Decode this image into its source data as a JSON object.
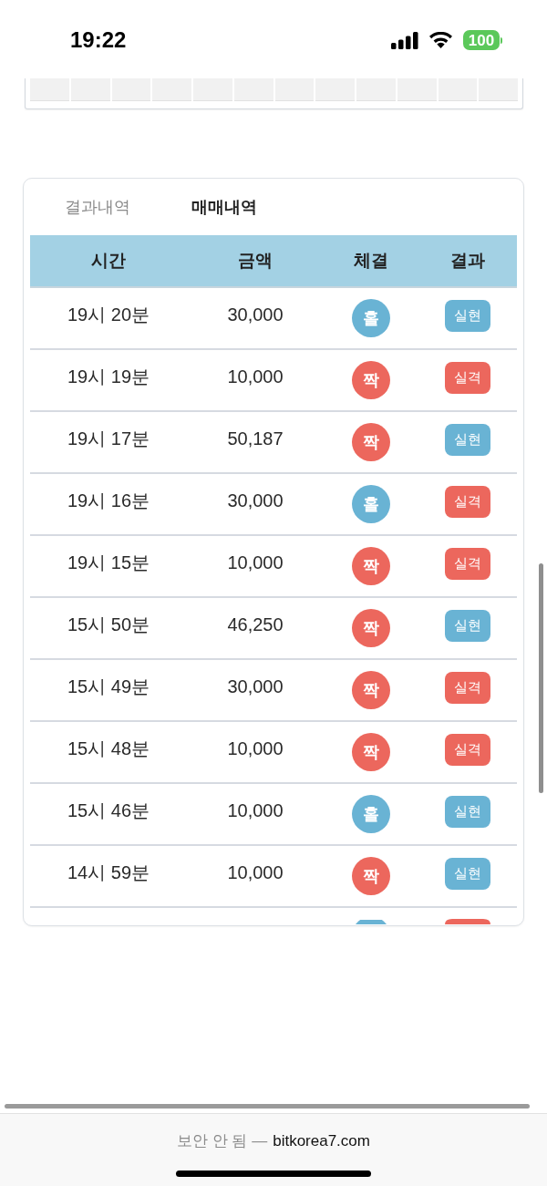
{
  "status_bar": {
    "time": "19:22",
    "battery": "100"
  },
  "tabs": [
    {
      "label": "결과내역",
      "selected": false
    },
    {
      "label": "매매내역",
      "selected": true
    }
  ],
  "table": {
    "columns": [
      "시간",
      "금액",
      "체결",
      "결과"
    ],
    "rows": [
      {
        "time": "19시 20분",
        "amount": "30,000",
        "fill": {
          "label": "홀",
          "kind": "odd"
        },
        "result": {
          "label": "실현",
          "kind": "win"
        }
      },
      {
        "time": "19시 19분",
        "amount": "10,000",
        "fill": {
          "label": "짝",
          "kind": "even"
        },
        "result": {
          "label": "실격",
          "kind": "lose"
        }
      },
      {
        "time": "19시 17분",
        "amount": "50,187",
        "fill": {
          "label": "짝",
          "kind": "even"
        },
        "result": {
          "label": "실현",
          "kind": "win"
        }
      },
      {
        "time": "19시 16분",
        "amount": "30,000",
        "fill": {
          "label": "홀",
          "kind": "odd"
        },
        "result": {
          "label": "실격",
          "kind": "lose"
        }
      },
      {
        "time": "19시 15분",
        "amount": "10,000",
        "fill": {
          "label": "짝",
          "kind": "even"
        },
        "result": {
          "label": "실격",
          "kind": "lose"
        }
      },
      {
        "time": "15시 50분",
        "amount": "46,250",
        "fill": {
          "label": "짝",
          "kind": "even"
        },
        "result": {
          "label": "실현",
          "kind": "win"
        }
      },
      {
        "time": "15시 49분",
        "amount": "30,000",
        "fill": {
          "label": "짝",
          "kind": "even"
        },
        "result": {
          "label": "실격",
          "kind": "lose"
        }
      },
      {
        "time": "15시 48분",
        "amount": "10,000",
        "fill": {
          "label": "짝",
          "kind": "even"
        },
        "result": {
          "label": "실격",
          "kind": "lose"
        }
      },
      {
        "time": "15시 46분",
        "amount": "10,000",
        "fill": {
          "label": "홀",
          "kind": "odd"
        },
        "result": {
          "label": "실현",
          "kind": "win"
        }
      },
      {
        "time": "14시 59분",
        "amount": "10,000",
        "fill": {
          "label": "짝",
          "kind": "even"
        },
        "result": {
          "label": "실현",
          "kind": "win"
        }
      }
    ],
    "cut_off_row": {
      "fill": {
        "kind": "odd"
      },
      "result": {
        "kind": "lose"
      }
    }
  },
  "address_bar": {
    "security": "보안 안 됨 —",
    "url": "bitkorea7.com"
  }
}
